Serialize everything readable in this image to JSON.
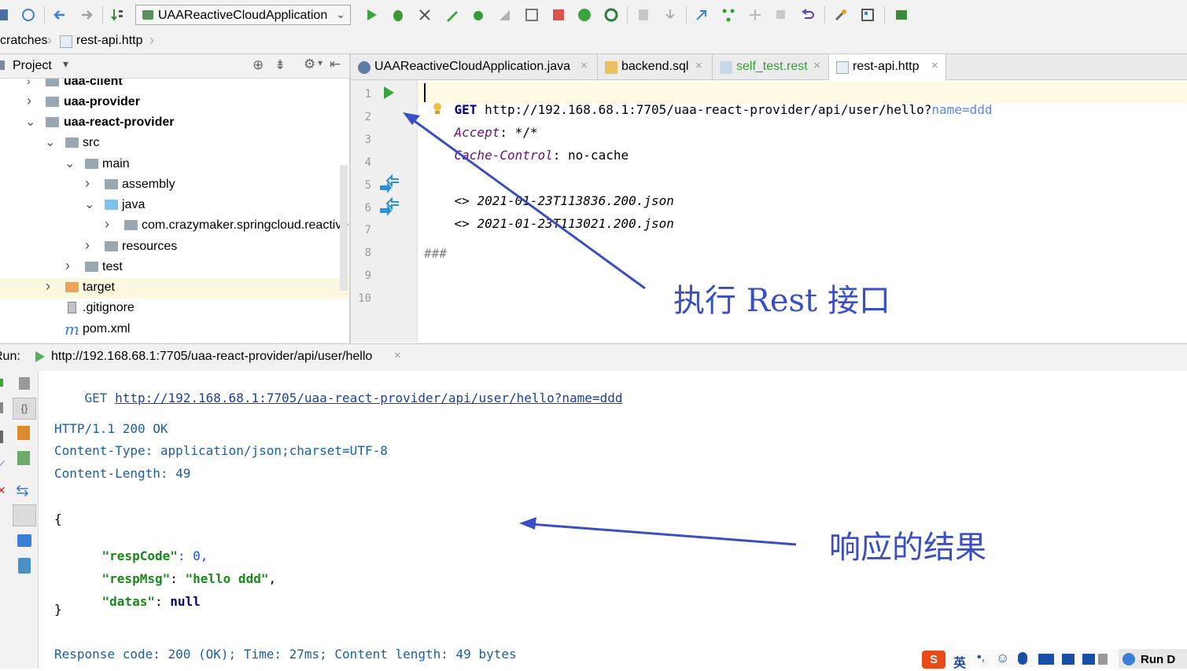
{
  "toolbar": {
    "run_config": "UAAReactiveCloudApplication"
  },
  "navbar": {
    "crumb_1": "cratches",
    "crumb_2": "rest-api.http"
  },
  "project": {
    "title": "Project",
    "tree": [
      {
        "label": "uaa-client",
        "bold": true
      },
      {
        "label": "uaa-provider",
        "bold": true
      },
      {
        "label": "uaa-react-provider",
        "bold": true
      },
      {
        "label": "src"
      },
      {
        "label": "main"
      },
      {
        "label": "assembly"
      },
      {
        "label": "java"
      },
      {
        "label": "com.crazymaker.springcloud.reactive"
      },
      {
        "label": "resources"
      },
      {
        "label": "test"
      },
      {
        "label": "target"
      },
      {
        "label": ".gitignore"
      },
      {
        "label": "pom.xml"
      }
    ]
  },
  "tabs": [
    {
      "label": "UAAReactiveCloudApplication.java"
    },
    {
      "label": "backend.sql"
    },
    {
      "label": "self_test.rest"
    },
    {
      "label": "rest-api.http"
    }
  ],
  "editor": {
    "line_numbers": [
      "1",
      "2",
      "3",
      "4",
      "5",
      "6",
      "7",
      "8",
      "9",
      "10"
    ],
    "line1_method": "GET",
    "line1_url": " http://192.168.68.1:7705/uaa-react-provider/api/user/hello?",
    "line1_param": "name=ddd",
    "line2_key": "Accept",
    "line2_val": ": */*",
    "line3_key": "Cache-Control",
    "line3_val": ": no-cache",
    "line5_prefix": "<> ",
    "line5_file": "2021-01-23T113836.200.json",
    "line6_prefix": "<> ",
    "line6_file": "2021-01-23T113021.200.json",
    "line8": "###"
  },
  "annotations": {
    "exec": "执行 Rest 接口",
    "result": "响应的结果"
  },
  "run": {
    "label": "Run:",
    "tab_url": "http://192.168.68.1:7705/uaa-react-provider/api/user/hello",
    "req_method": "GET ",
    "req_url": "http://192.168.68.1:7705/uaa-react-provider/api/user/hello?name=ddd",
    "status": "HTTP/1.1 200 OK",
    "content_type": "Content-Type: application/json;charset=UTF-8",
    "content_length": "Content-Length: 49",
    "brace_open": "{",
    "k1": "\"respCode\"",
    "v1": ": 0,",
    "k2": "\"respMsg\"",
    "v2_sep": ": ",
    "v2": "\"hello ddd\"",
    "v2_end": ",",
    "k3": "\"datas\"",
    "v3_sep": ": ",
    "v3": "null",
    "brace_close": "}",
    "summary": "Response code: 200 (OK); Time: 27ms; Content length: 49 bytes"
  },
  "taskbar": {
    "ime_lang": "英",
    "run_btn": "Run D"
  }
}
